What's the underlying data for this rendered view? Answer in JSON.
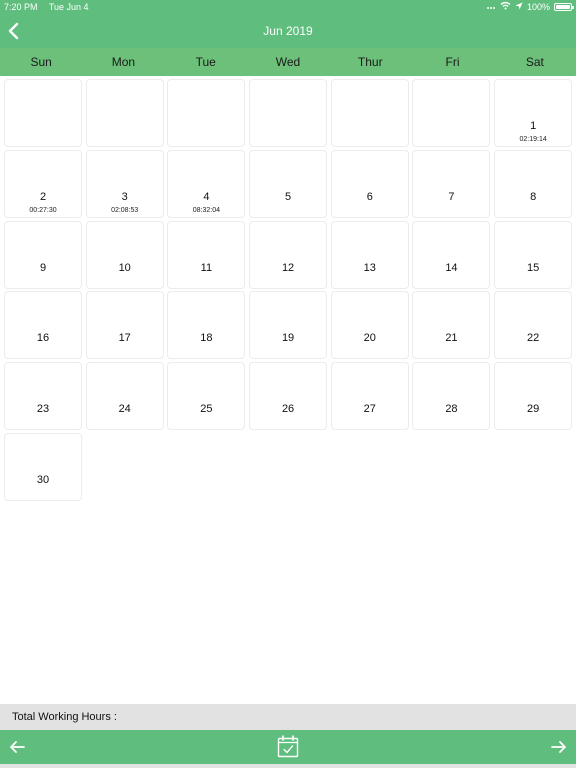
{
  "status": {
    "time": "7:20 PM",
    "date": "Tue Jun 4",
    "battery": "100%"
  },
  "header": {
    "title": "Jun 2019"
  },
  "weekdays": [
    "Sun",
    "Mon",
    "Tue",
    "Wed",
    "Thur",
    "Fri",
    "Sat"
  ],
  "calendar": {
    "leading_blanks": 6,
    "days": [
      {
        "day": "1",
        "time": "02:19:14"
      },
      {
        "day": "2",
        "time": "00:27:30"
      },
      {
        "day": "3",
        "time": "02:08:53"
      },
      {
        "day": "4",
        "time": "08:32:04"
      },
      {
        "day": "5",
        "time": ""
      },
      {
        "day": "6",
        "time": ""
      },
      {
        "day": "7",
        "time": ""
      },
      {
        "day": "8",
        "time": ""
      },
      {
        "day": "9",
        "time": ""
      },
      {
        "day": "10",
        "time": ""
      },
      {
        "day": "11",
        "time": ""
      },
      {
        "day": "12",
        "time": ""
      },
      {
        "day": "13",
        "time": ""
      },
      {
        "day": "14",
        "time": ""
      },
      {
        "day": "15",
        "time": ""
      },
      {
        "day": "16",
        "time": ""
      },
      {
        "day": "17",
        "time": ""
      },
      {
        "day": "18",
        "time": ""
      },
      {
        "day": "19",
        "time": ""
      },
      {
        "day": "20",
        "time": ""
      },
      {
        "day": "21",
        "time": ""
      },
      {
        "day": "22",
        "time": ""
      },
      {
        "day": "23",
        "time": ""
      },
      {
        "day": "24",
        "time": ""
      },
      {
        "day": "25",
        "time": ""
      },
      {
        "day": "26",
        "time": ""
      },
      {
        "day": "27",
        "time": ""
      },
      {
        "day": "28",
        "time": ""
      },
      {
        "day": "29",
        "time": ""
      },
      {
        "day": "30",
        "time": ""
      }
    ]
  },
  "footer": {
    "total_label": "Total Working Hours :"
  },
  "icons": {
    "back": "chevron-left-icon",
    "prev": "arrow-left-icon",
    "next": "arrow-right-icon",
    "today": "calendar-check-icon"
  },
  "colors": {
    "bar": "#5fbe7d",
    "weekday_bar": "#6cc07a",
    "footer_gray": "#e2e2e2"
  }
}
